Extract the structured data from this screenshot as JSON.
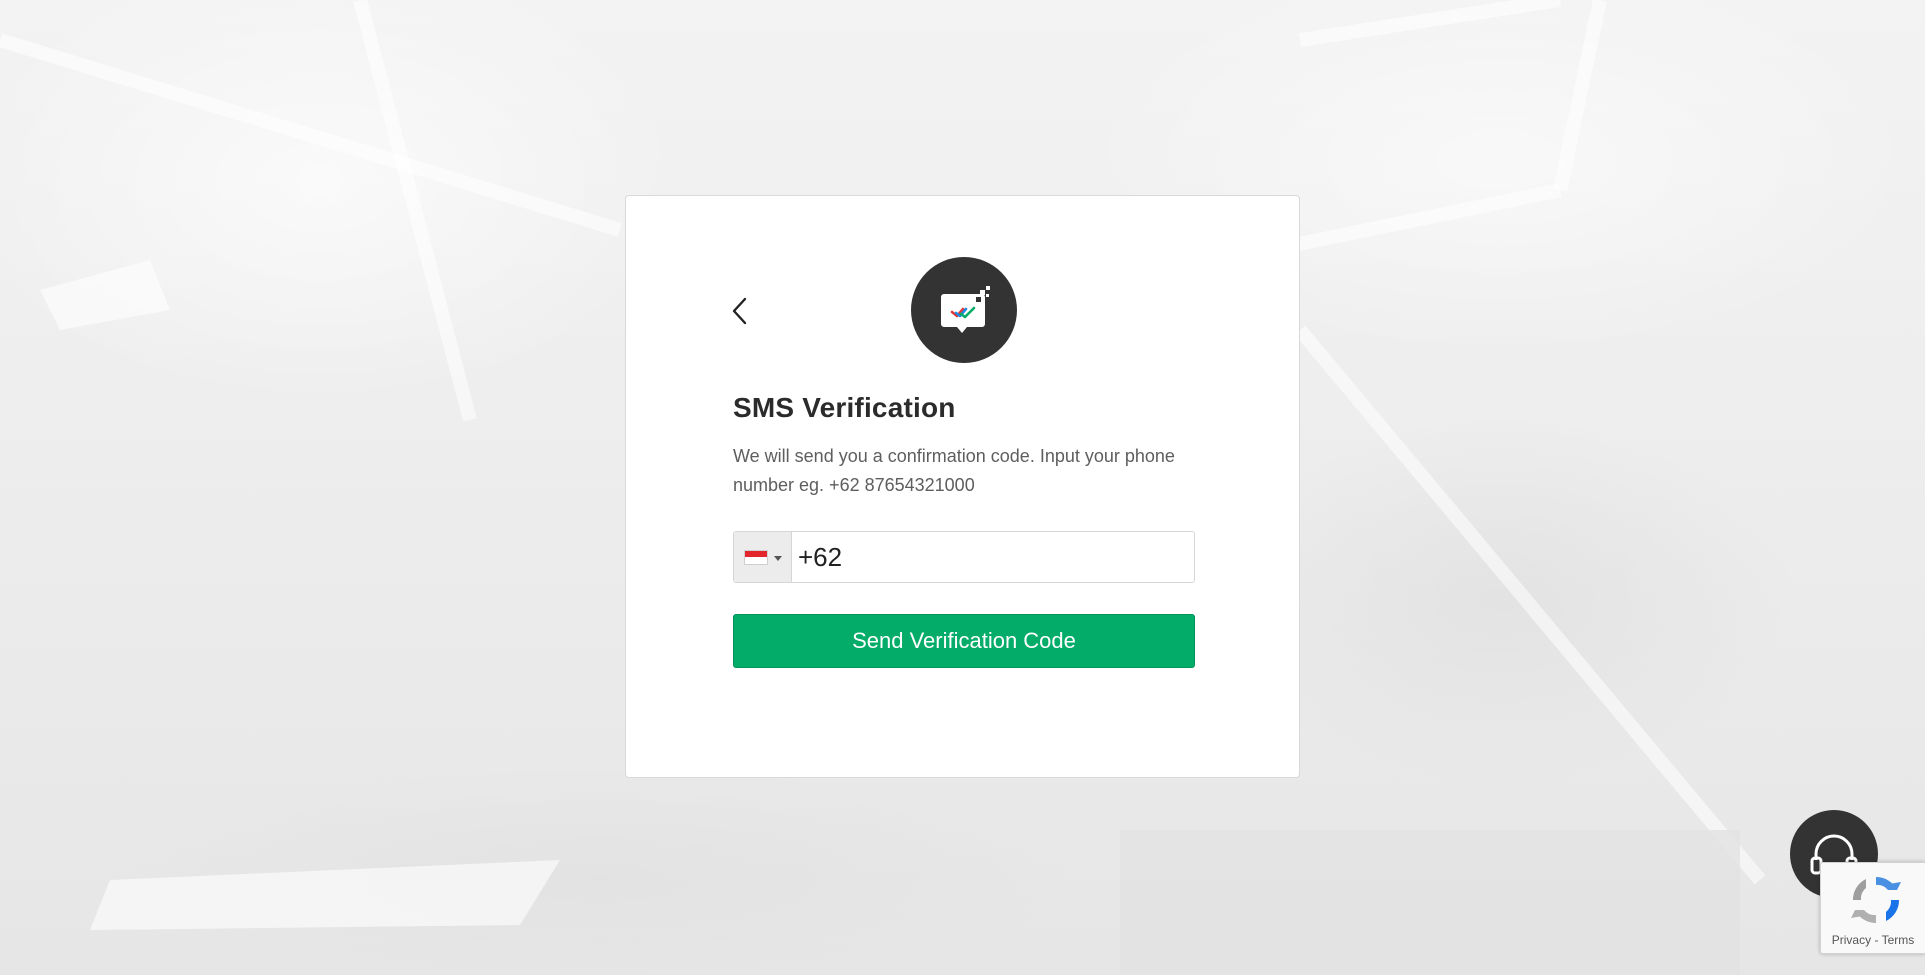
{
  "verification": {
    "title": "SMS Verification",
    "description": "We will send you a confirmation code. Input your phone number eg. +62 87654321000",
    "phone": {
      "dial_code_value": "+62",
      "country_flag": "indonesia-flag"
    },
    "send_button_label": "Send Verification Code"
  },
  "icons": {
    "back": "chevron-left-icon",
    "hero": "sms-check-icon",
    "support": "headset-icon",
    "recaptcha": "recaptcha-icon"
  },
  "recaptcha": {
    "privacy_label": "Privacy",
    "separator": " - ",
    "terms_label": "Terms"
  },
  "colors": {
    "primary_green": "#03ac68",
    "dark_circle": "#333333",
    "flag_red": "#e3262b"
  }
}
